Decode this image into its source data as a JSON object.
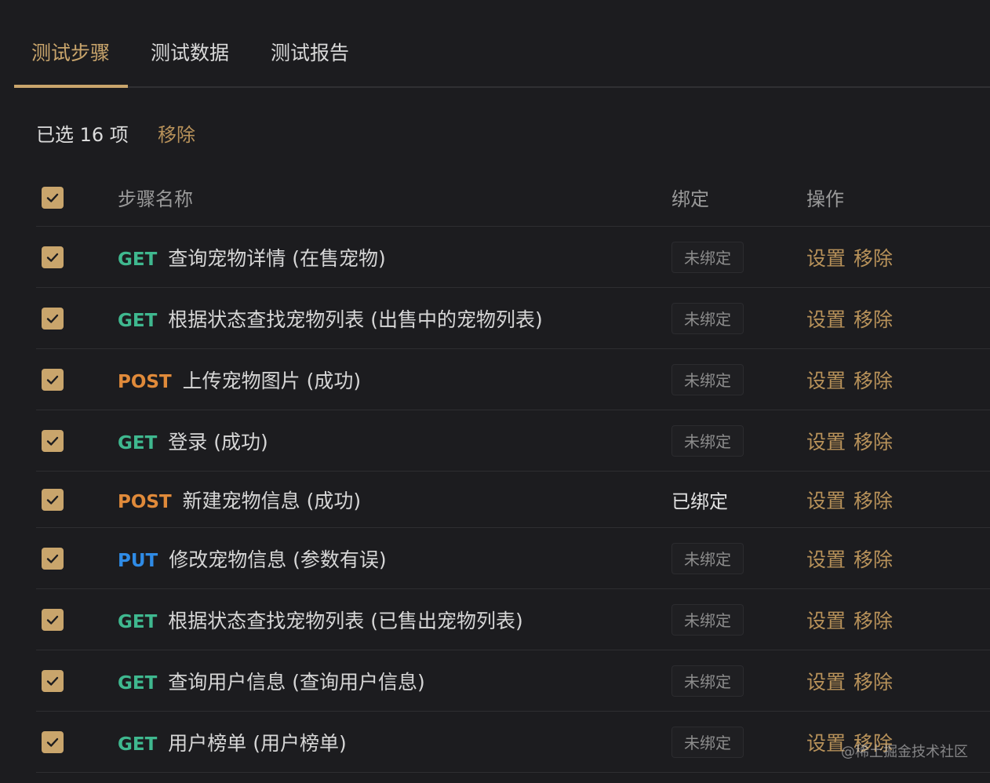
{
  "tabs": [
    {
      "label": "测试步骤",
      "active": true
    },
    {
      "label": "测试数据",
      "active": false
    },
    {
      "label": "测试报告",
      "active": false
    }
  ],
  "selection": {
    "count_text": "已选 16 项",
    "remove_label": "移除"
  },
  "table": {
    "headers": {
      "name": "步骤名称",
      "bind": "绑定",
      "ops": "操作"
    },
    "op_labels": {
      "settings": "设置",
      "remove": "移除"
    },
    "rows": [
      {
        "method": "GET",
        "title": "查询宠物详情 (在售宠物)",
        "bind": "未绑定",
        "bound": false
      },
      {
        "method": "GET",
        "title": "根据状态查找宠物列表 (出售中的宠物列表)",
        "bind": "未绑定",
        "bound": false
      },
      {
        "method": "POST",
        "title": "上传宠物图片 (成功)",
        "bind": "未绑定",
        "bound": false
      },
      {
        "method": "GET",
        "title": "登录 (成功)",
        "bind": "未绑定",
        "bound": false
      },
      {
        "method": "POST",
        "title": "新建宠物信息 (成功)",
        "bind": "已绑定",
        "bound": true
      },
      {
        "method": "PUT",
        "title": "修改宠物信息 (参数有误)",
        "bind": "未绑定",
        "bound": false
      },
      {
        "method": "GET",
        "title": "根据状态查找宠物列表 (已售出宠物列表)",
        "bind": "未绑定",
        "bound": false
      },
      {
        "method": "GET",
        "title": "查询用户信息 (查询用户信息)",
        "bind": "未绑定",
        "bound": false
      },
      {
        "method": "GET",
        "title": "用户榜单 (用户榜单)",
        "bind": "未绑定",
        "bound": false
      }
    ]
  },
  "watermark": "@稀土掘金技术社区",
  "colors": {
    "accent": "#c9a56c",
    "get": "#3fb88f",
    "post": "#e08a3a",
    "put": "#2f8be6",
    "background": "#1c1c1f"
  }
}
